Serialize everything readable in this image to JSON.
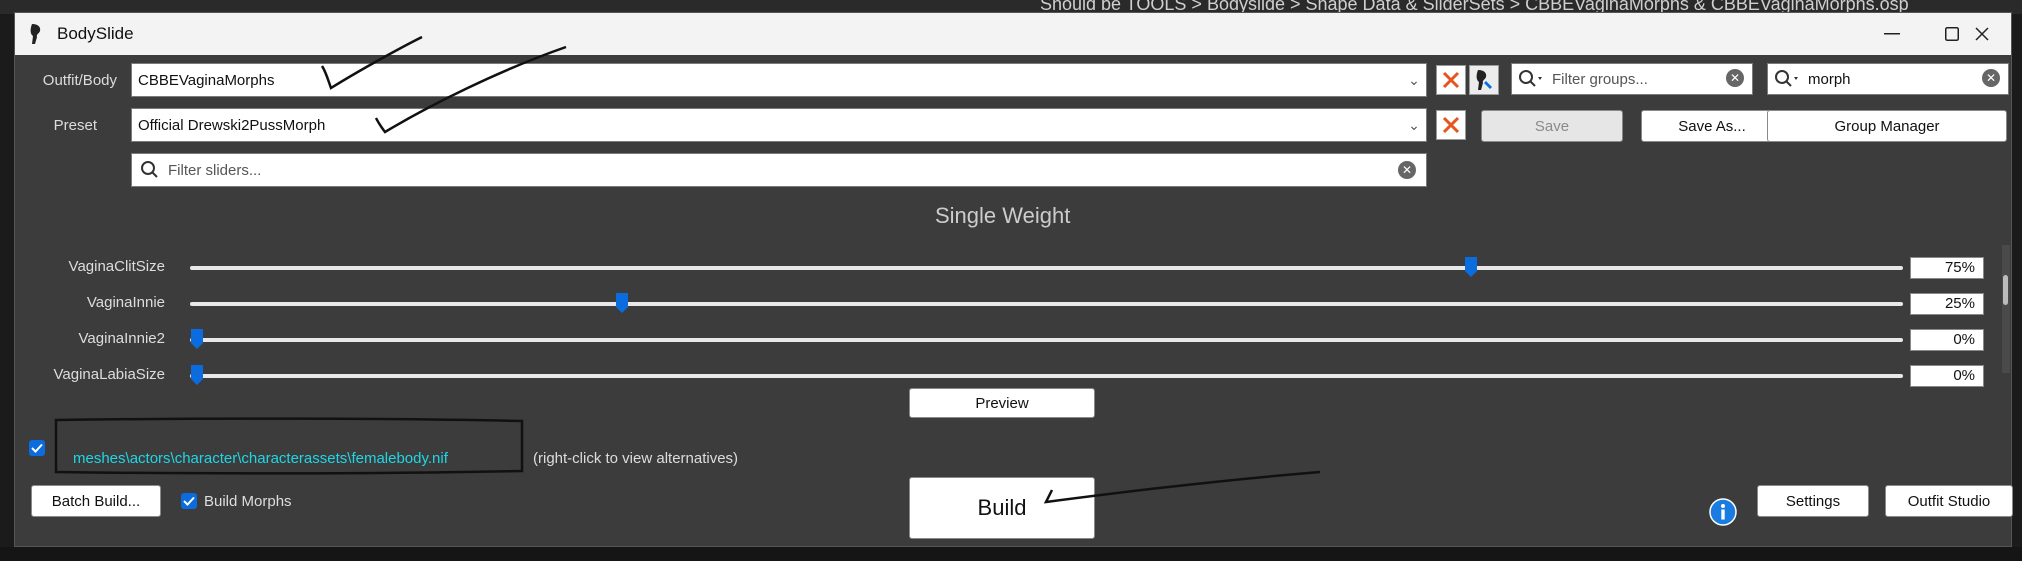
{
  "background": {
    "top_text": "Should be TOOLS > Bodyslide > Shape Data & SliderSets > CBBEVaginaMorphs & CBBEVaginaMorphs.osp"
  },
  "window": {
    "title": "BodySlide",
    "controls": {
      "minimize": "—",
      "maximize": "☐",
      "close": "✕"
    }
  },
  "outfit": {
    "label": "Outfit/Body",
    "value": "CBBEVaginaMorphs"
  },
  "preset": {
    "label": "Preset",
    "value": "Official Drewski2PussMorph"
  },
  "group_filter": {
    "placeholder": "Filter groups..."
  },
  "outfit_filter": {
    "value": "morph"
  },
  "buttons": {
    "save": "Save",
    "save_as": "Save As...",
    "group_manager": "Group Manager",
    "preview": "Preview",
    "batch_build": "Batch Build...",
    "build": "Build",
    "settings": "Settings",
    "outfit_studio": "Outfit Studio"
  },
  "slider_filter": {
    "placeholder": "Filter sliders..."
  },
  "section_title": "Single Weight",
  "sliders": [
    {
      "name": "VaginaClitSize",
      "value": 75,
      "display": "75%"
    },
    {
      "name": "VaginaInnie",
      "value": 25,
      "display": "25%"
    },
    {
      "name": "VaginaInnie2",
      "value": 0,
      "display": "0%"
    },
    {
      "name": "VaginaLabiaSize",
      "value": 0,
      "display": "0%"
    }
  ],
  "output_path": {
    "checked": true,
    "path": "meshes\\actors\\character\\characterassets\\femalebody.nif",
    "hint": "(right-click to view alternatives)"
  },
  "build_morphs": {
    "checked": true,
    "label": "Build Morphs"
  },
  "colors": {
    "accent": "#0a6cdf",
    "path": "#1fd6e6",
    "x_icon": "#e8541e"
  },
  "icons": {
    "info": "info-icon",
    "clear": "clear-icon",
    "search": "search-icon"
  }
}
